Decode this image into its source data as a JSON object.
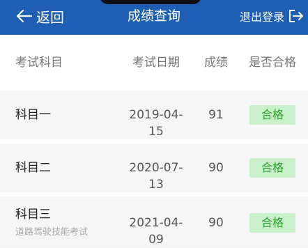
{
  "header": {
    "back_label": "返回",
    "title": "成绩查询",
    "logout_label": "退出登录",
    "color": "#1f5fb3"
  },
  "columns": {
    "subject": "考试科目",
    "date": "考试日期",
    "score": "成绩",
    "pass": "是否合格"
  },
  "rows": [
    {
      "subject": "科目一",
      "note": "",
      "date": "2019-04-15",
      "score": "91",
      "pass": "合格"
    },
    {
      "subject": "科目二",
      "note": "",
      "date": "2020-07-13",
      "score": "90",
      "pass": "合格"
    },
    {
      "subject": "科目三",
      "note": "道路驾驶技能考试",
      "date": "2021-04-09",
      "score": "90",
      "pass": "合格"
    }
  ],
  "pass_badge_color": "#c9f1c9"
}
